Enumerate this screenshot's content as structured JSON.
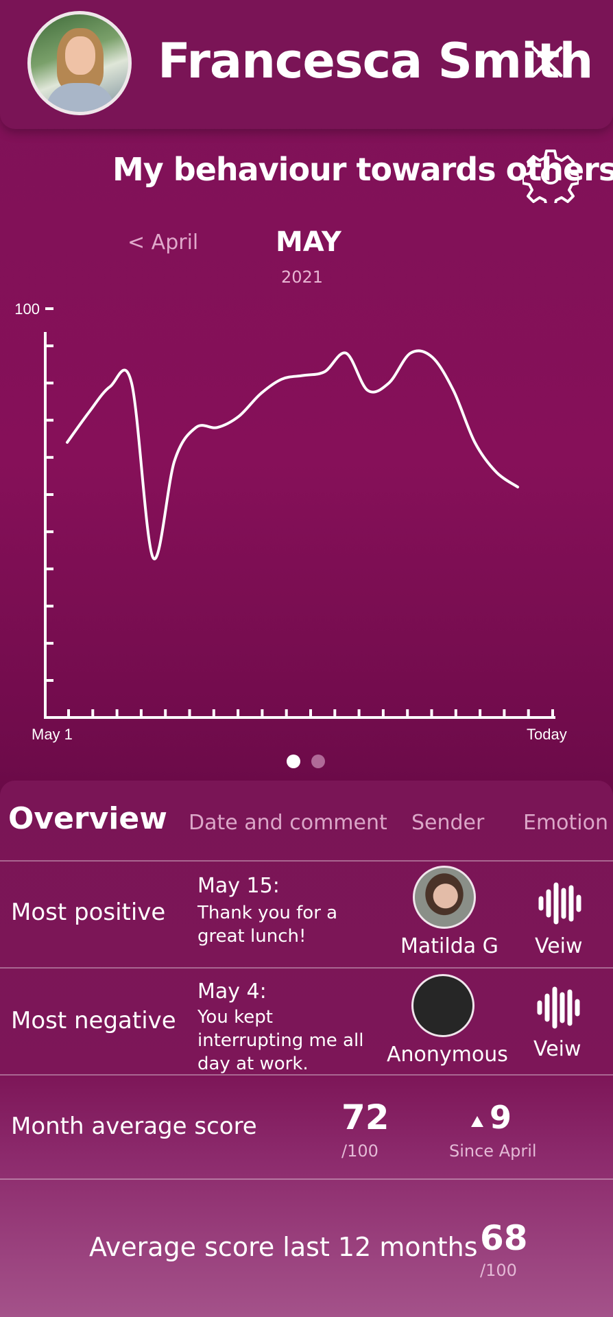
{
  "header": {
    "user_name": "Francesca Smith"
  },
  "page": {
    "title": "My behaviour towards others"
  },
  "month_nav": {
    "previous_label": "< April",
    "current_month": "MAY",
    "current_year": "2021"
  },
  "chart_data": {
    "type": "line",
    "title": "",
    "xlabel": "",
    "ylabel": "",
    "x_tick_labels": [
      "May 1",
      "Today"
    ],
    "y_tick_labels": [
      "100"
    ],
    "ylim": [
      0,
      100
    ],
    "grid": false,
    "x": [
      1,
      2,
      3,
      4,
      5,
      6,
      7,
      8,
      9,
      10,
      11,
      12,
      13,
      14,
      15,
      16,
      17,
      18,
      19,
      20,
      21,
      22
    ],
    "series": [
      {
        "values": [
          74,
          82,
          89,
          90,
          43,
          69,
          78,
          78,
          81,
          87,
          91,
          92,
          93,
          98,
          88,
          90,
          98,
          97,
          88,
          74,
          66,
          62
        ]
      }
    ]
  },
  "pager": {
    "pages": 2,
    "active": 0
  },
  "overview": {
    "title": "Overview",
    "columns": {
      "date": "Date and comment",
      "sender": "Sender",
      "emotion": "Emotion"
    },
    "rows": [
      {
        "label": "Most positive",
        "date": "May 15:",
        "comment": "Thank you for a great lunch!",
        "sender": "Matilda G",
        "view": "Veiw"
      },
      {
        "label": "Most negative",
        "date": "May 4:",
        "comment": "You kept interrupting me all day at work.",
        "sender": "Anonymous",
        "view": "Veiw"
      }
    ],
    "month_average": {
      "label": "Month average score",
      "score": "72",
      "out_of": "/100",
      "change": "9",
      "change_label": "Since April"
    },
    "year_average": {
      "label": "Average score last 12 months",
      "score": "68",
      "out_of": "/100"
    }
  },
  "colors": {
    "background": "#861059",
    "header": "#7a1456",
    "accent_muted": "#dba7c8"
  },
  "icons": {
    "close": "close-icon",
    "settings": "gear-icon",
    "emotion": "audio-wave-icon",
    "change": "triangle-up-icon"
  }
}
